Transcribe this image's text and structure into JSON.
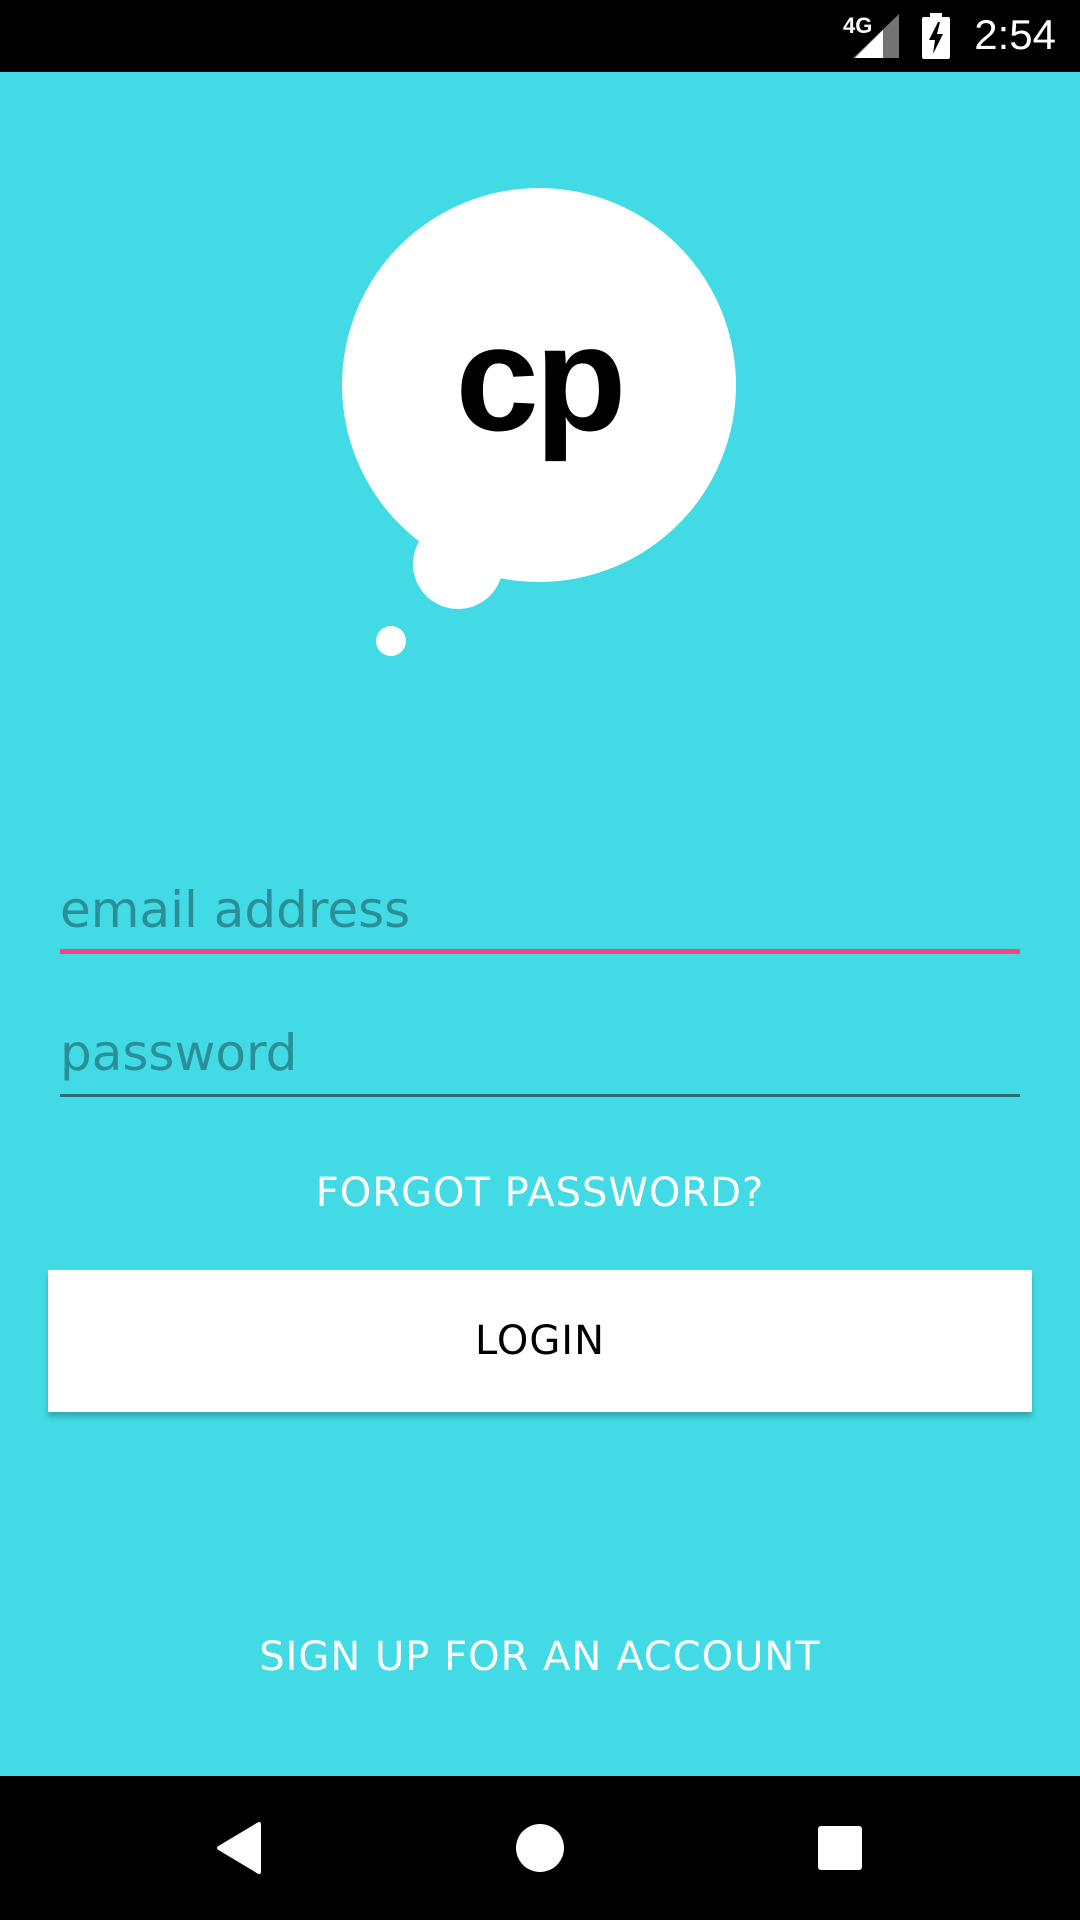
{
  "status_bar": {
    "network": "4G",
    "time": "2:54",
    "icons": [
      "signal-icon",
      "battery-charging-icon"
    ]
  },
  "logo": {
    "text": "cp"
  },
  "form": {
    "email_placeholder": "email address",
    "password_placeholder": "password",
    "forgot_label": "FORGOT PASSWORD?",
    "login_label": "LOGIN",
    "signup_label": "SIGN UP FOR AN ACCOUNT"
  },
  "nav_bar": {
    "icons": [
      "back-icon",
      "home-icon",
      "recents-icon"
    ]
  },
  "colors": {
    "background": "#42DAE5",
    "accent": "#FF4081",
    "button": "#FFFFFF",
    "text_on_bg": "#FFFFFF",
    "placeholder": "#2B8F98"
  }
}
